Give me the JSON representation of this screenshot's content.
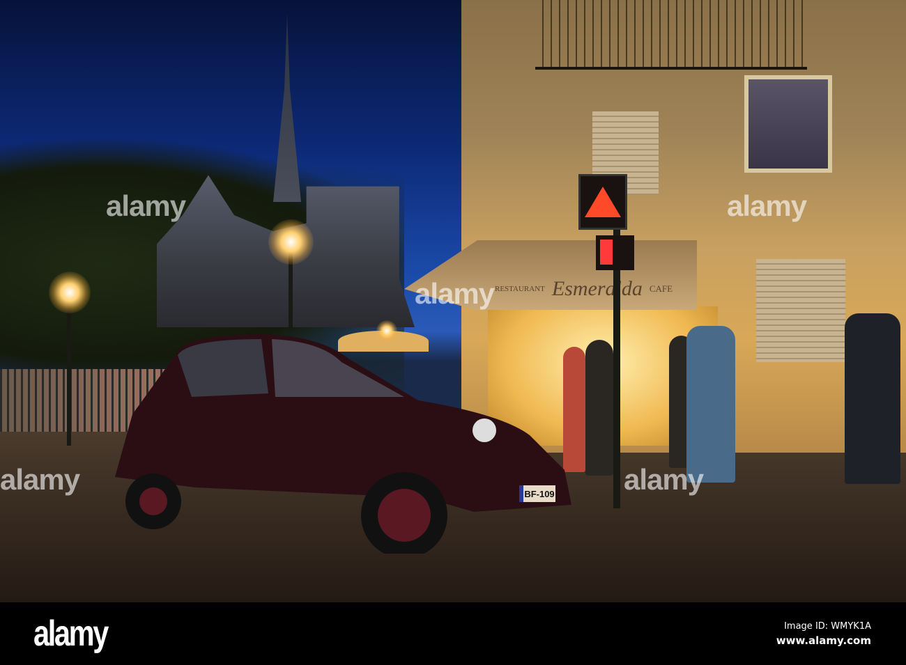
{
  "photo": {
    "shop_sign": {
      "name": "Esmeralda",
      "left": "RESTAURANT",
      "right": "CAFE"
    },
    "license_plate": "BF-109",
    "watermark": "alamy"
  },
  "footer": {
    "logo": "alamy",
    "image_id": "Image ID: WMYK1A",
    "url": "www.alamy.com"
  }
}
